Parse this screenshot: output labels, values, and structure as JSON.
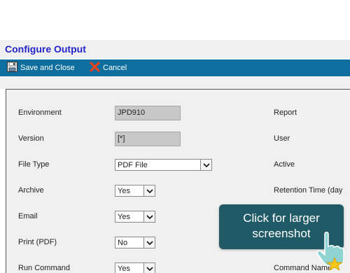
{
  "page": {
    "title": "Configure Output"
  },
  "toolbar": {
    "save_label": "Save and Close",
    "cancel_label": "Cancel"
  },
  "form": {
    "environment": {
      "label": "Environment",
      "value": "JPD910"
    },
    "version": {
      "label": "Version",
      "value": "[*]"
    },
    "file_type": {
      "label": "File Type",
      "value": "PDF File"
    },
    "archive": {
      "label": "Archive",
      "value": "Yes"
    },
    "email": {
      "label": "Email",
      "value": "Yes"
    },
    "print_pdf": {
      "label": "Print (PDF)",
      "value": "No"
    },
    "run_command": {
      "label": "Run Command",
      "value": "Yes"
    }
  },
  "right_labels": {
    "report": "Report",
    "user": "User",
    "active": "Active",
    "retention_time": "Retention Time (day",
    "command_name": "Command Name"
  },
  "overlay": {
    "callout_line1": "Click for larger",
    "callout_line2": "screenshot"
  },
  "colors": {
    "toolbar_bg": "#0e6f9e",
    "title_text": "#2323c8",
    "callout_bg": "#1f5a66",
    "panel_bg": "#f0f0f0"
  }
}
